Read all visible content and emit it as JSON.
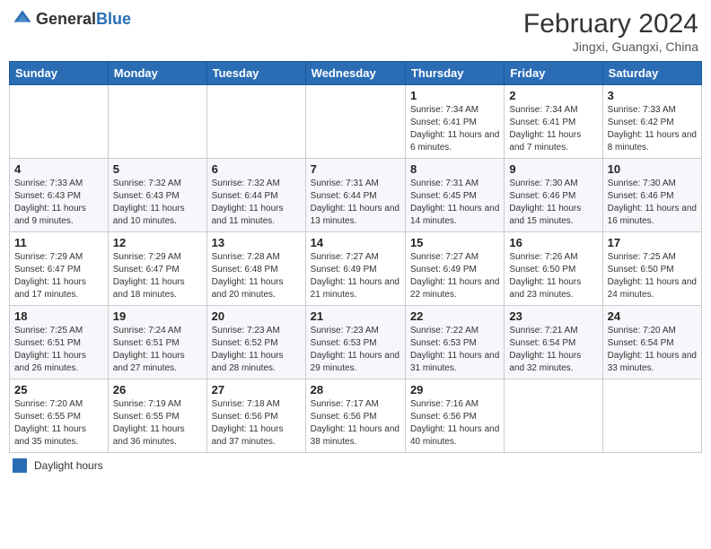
{
  "header": {
    "logo": {
      "general": "General",
      "blue": "Blue"
    },
    "title": "February 2024",
    "location": "Jingxi, Guangxi, China"
  },
  "weekdays": [
    "Sunday",
    "Monday",
    "Tuesday",
    "Wednesday",
    "Thursday",
    "Friday",
    "Saturday"
  ],
  "weeks": [
    [
      {
        "day": "",
        "info": ""
      },
      {
        "day": "",
        "info": ""
      },
      {
        "day": "",
        "info": ""
      },
      {
        "day": "",
        "info": ""
      },
      {
        "day": "1",
        "info": "Sunrise: 7:34 AM\nSunset: 6:41 PM\nDaylight: 11 hours and 6 minutes."
      },
      {
        "day": "2",
        "info": "Sunrise: 7:34 AM\nSunset: 6:41 PM\nDaylight: 11 hours and 7 minutes."
      },
      {
        "day": "3",
        "info": "Sunrise: 7:33 AM\nSunset: 6:42 PM\nDaylight: 11 hours and 8 minutes."
      }
    ],
    [
      {
        "day": "4",
        "info": "Sunrise: 7:33 AM\nSunset: 6:43 PM\nDaylight: 11 hours and 9 minutes."
      },
      {
        "day": "5",
        "info": "Sunrise: 7:32 AM\nSunset: 6:43 PM\nDaylight: 11 hours and 10 minutes."
      },
      {
        "day": "6",
        "info": "Sunrise: 7:32 AM\nSunset: 6:44 PM\nDaylight: 11 hours and 11 minutes."
      },
      {
        "day": "7",
        "info": "Sunrise: 7:31 AM\nSunset: 6:44 PM\nDaylight: 11 hours and 13 minutes."
      },
      {
        "day": "8",
        "info": "Sunrise: 7:31 AM\nSunset: 6:45 PM\nDaylight: 11 hours and 14 minutes."
      },
      {
        "day": "9",
        "info": "Sunrise: 7:30 AM\nSunset: 6:46 PM\nDaylight: 11 hours and 15 minutes."
      },
      {
        "day": "10",
        "info": "Sunrise: 7:30 AM\nSunset: 6:46 PM\nDaylight: 11 hours and 16 minutes."
      }
    ],
    [
      {
        "day": "11",
        "info": "Sunrise: 7:29 AM\nSunset: 6:47 PM\nDaylight: 11 hours and 17 minutes."
      },
      {
        "day": "12",
        "info": "Sunrise: 7:29 AM\nSunset: 6:47 PM\nDaylight: 11 hours and 18 minutes."
      },
      {
        "day": "13",
        "info": "Sunrise: 7:28 AM\nSunset: 6:48 PM\nDaylight: 11 hours and 20 minutes."
      },
      {
        "day": "14",
        "info": "Sunrise: 7:27 AM\nSunset: 6:49 PM\nDaylight: 11 hours and 21 minutes."
      },
      {
        "day": "15",
        "info": "Sunrise: 7:27 AM\nSunset: 6:49 PM\nDaylight: 11 hours and 22 minutes."
      },
      {
        "day": "16",
        "info": "Sunrise: 7:26 AM\nSunset: 6:50 PM\nDaylight: 11 hours and 23 minutes."
      },
      {
        "day": "17",
        "info": "Sunrise: 7:25 AM\nSunset: 6:50 PM\nDaylight: 11 hours and 24 minutes."
      }
    ],
    [
      {
        "day": "18",
        "info": "Sunrise: 7:25 AM\nSunset: 6:51 PM\nDaylight: 11 hours and 26 minutes."
      },
      {
        "day": "19",
        "info": "Sunrise: 7:24 AM\nSunset: 6:51 PM\nDaylight: 11 hours and 27 minutes."
      },
      {
        "day": "20",
        "info": "Sunrise: 7:23 AM\nSunset: 6:52 PM\nDaylight: 11 hours and 28 minutes."
      },
      {
        "day": "21",
        "info": "Sunrise: 7:23 AM\nSunset: 6:53 PM\nDaylight: 11 hours and 29 minutes."
      },
      {
        "day": "22",
        "info": "Sunrise: 7:22 AM\nSunset: 6:53 PM\nDaylight: 11 hours and 31 minutes."
      },
      {
        "day": "23",
        "info": "Sunrise: 7:21 AM\nSunset: 6:54 PM\nDaylight: 11 hours and 32 minutes."
      },
      {
        "day": "24",
        "info": "Sunrise: 7:20 AM\nSunset: 6:54 PM\nDaylight: 11 hours and 33 minutes."
      }
    ],
    [
      {
        "day": "25",
        "info": "Sunrise: 7:20 AM\nSunset: 6:55 PM\nDaylight: 11 hours and 35 minutes."
      },
      {
        "day": "26",
        "info": "Sunrise: 7:19 AM\nSunset: 6:55 PM\nDaylight: 11 hours and 36 minutes."
      },
      {
        "day": "27",
        "info": "Sunrise: 7:18 AM\nSunset: 6:56 PM\nDaylight: 11 hours and 37 minutes."
      },
      {
        "day": "28",
        "info": "Sunrise: 7:17 AM\nSunset: 6:56 PM\nDaylight: 11 hours and 38 minutes."
      },
      {
        "day": "29",
        "info": "Sunrise: 7:16 AM\nSunset: 6:56 PM\nDaylight: 11 hours and 40 minutes."
      },
      {
        "day": "",
        "info": ""
      },
      {
        "day": "",
        "info": ""
      }
    ]
  ],
  "footer": {
    "daylight_label": "Daylight hours"
  }
}
